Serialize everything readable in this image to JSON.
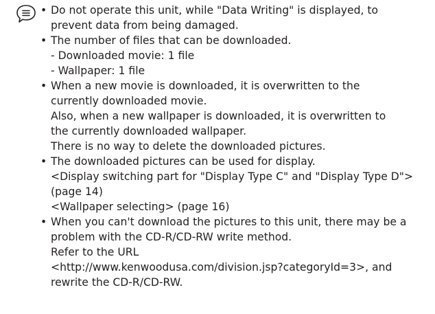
{
  "icon": {
    "name": "note-icon"
  },
  "bullet_char": "•",
  "notes": [
    {
      "lines": [
        "Do not operate this unit, while \"Data Writing\" is displayed, to",
        "prevent data from being damaged."
      ]
    },
    {
      "lines": [
        "The number of files that can be downloaded.",
        "- Downloaded movie: 1 file",
        "- Wallpaper: 1 file"
      ]
    },
    {
      "lines": [
        "When a new movie is downloaded, it is overwritten to the",
        "currently downloaded movie.",
        "Also, when a new wallpaper is downloaded, it is overwritten to",
        "the currently downloaded wallpaper.",
        "There is no way to delete the downloaded pictures."
      ]
    },
    {
      "lines": [
        "The downloaded pictures can be used for display.",
        "<Display switching part for \"Display Type C\" and \"Display Type D\">",
        "(page 14)",
        "<Wallpaper selecting> (page 16)"
      ]
    },
    {
      "lines": [
        "When you can't download the pictures to this unit, there may be a",
        "problem with the CD-R/CD-RW write method.",
        "Refer to the URL",
        "<http://www.kenwoodusa.com/division.jsp?categoryId=3>, and",
        "rewrite the CD-R/CD-RW."
      ]
    }
  ]
}
